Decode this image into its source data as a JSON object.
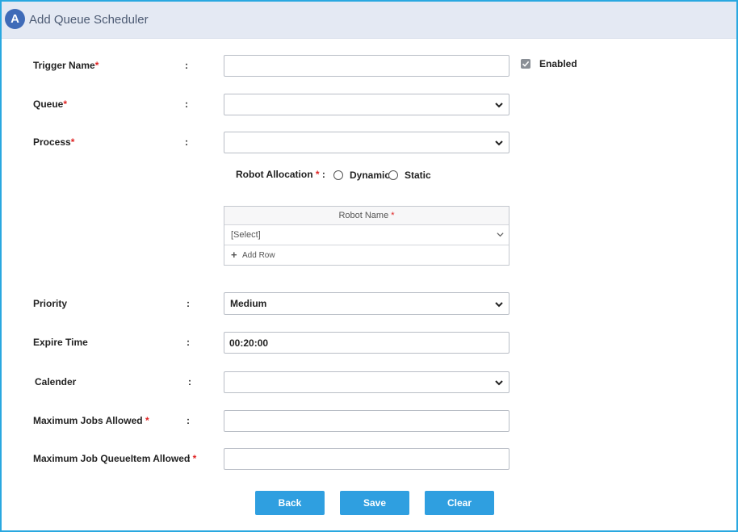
{
  "header": {
    "badge": "A",
    "title": "Add Queue Scheduler"
  },
  "form": {
    "trigger_name": {
      "label": "Trigger Name",
      "required": "*",
      "colon": ":",
      "value": ""
    },
    "enabled": {
      "label": "Enabled",
      "checked": true
    },
    "queue": {
      "label": "Queue",
      "required": "*",
      "colon": ":",
      "value": ""
    },
    "process": {
      "label": "Process",
      "required": "*",
      "colon": ":",
      "value": ""
    },
    "robot_allocation": {
      "label": "Robot Allocation",
      "required": "*",
      "colon": ":",
      "options": [
        "Dynamic",
        "Static"
      ]
    },
    "robot_grid": {
      "header": "Robot Name",
      "required": "*",
      "row_value": "[Select]",
      "add_row_label": "Add Row"
    },
    "priority": {
      "label": "Priority",
      "colon": ":",
      "value": "Medium"
    },
    "expire_time": {
      "label": "Expire Time",
      "colon": ":",
      "value": "00:20:00"
    },
    "calender": {
      "label": "Calender",
      "colon": ":",
      "value": ""
    },
    "max_jobs": {
      "label": "Maximum Jobs Allowed",
      "required": "*",
      "colon": ":",
      "value": ""
    },
    "max_queue_items": {
      "label": "Maximum Job QueueItem Allowed",
      "required": "*",
      "colon": ":",
      "value": ""
    }
  },
  "buttons": {
    "back": "Back",
    "save": "Save",
    "clear": "Clear"
  },
  "colors": {
    "accent": "#2f9fe0",
    "frame_border": "#29a8e0",
    "header_bg": "#e4e9f3",
    "required": "#e02424"
  }
}
